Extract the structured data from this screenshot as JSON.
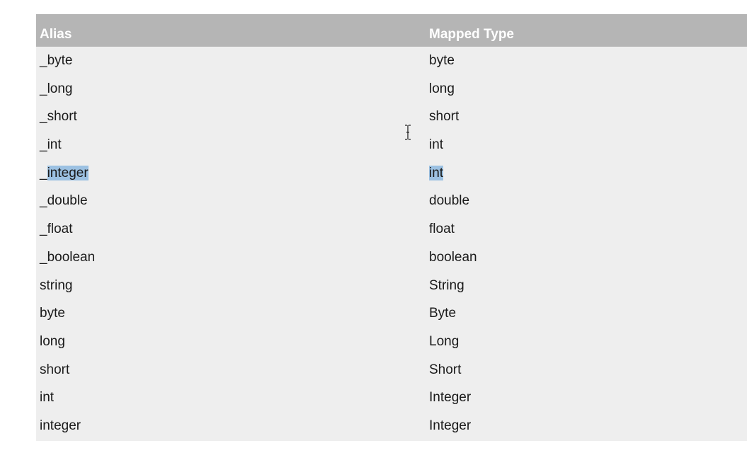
{
  "table": {
    "headers": {
      "alias": "Alias",
      "mapped_type": "Mapped Type"
    },
    "rows": [
      {
        "alias": "_byte",
        "mapped_type": "byte"
      },
      {
        "alias": "_long",
        "mapped_type": "long"
      },
      {
        "alias": "_short",
        "mapped_type": "short"
      },
      {
        "alias": "_int",
        "mapped_type": "int"
      },
      {
        "alias": "_integer",
        "mapped_type": "int",
        "alias_prefix": "_",
        "alias_selected": "integer"
      },
      {
        "alias": "_double",
        "mapped_type": "double"
      },
      {
        "alias": "_float",
        "mapped_type": "float"
      },
      {
        "alias": "_boolean",
        "mapped_type": "boolean"
      },
      {
        "alias": "string",
        "mapped_type": "String"
      },
      {
        "alias": "byte",
        "mapped_type": "Byte"
      },
      {
        "alias": "long",
        "mapped_type": "Long"
      },
      {
        "alias": "short",
        "mapped_type": "Short"
      },
      {
        "alias": "int",
        "mapped_type": "Integer"
      },
      {
        "alias": "integer",
        "mapped_type": "Integer"
      }
    ]
  },
  "selection": {
    "highlight_color": "#9cc1e2"
  },
  "cursor": {
    "icon": "text-cursor-icon"
  }
}
